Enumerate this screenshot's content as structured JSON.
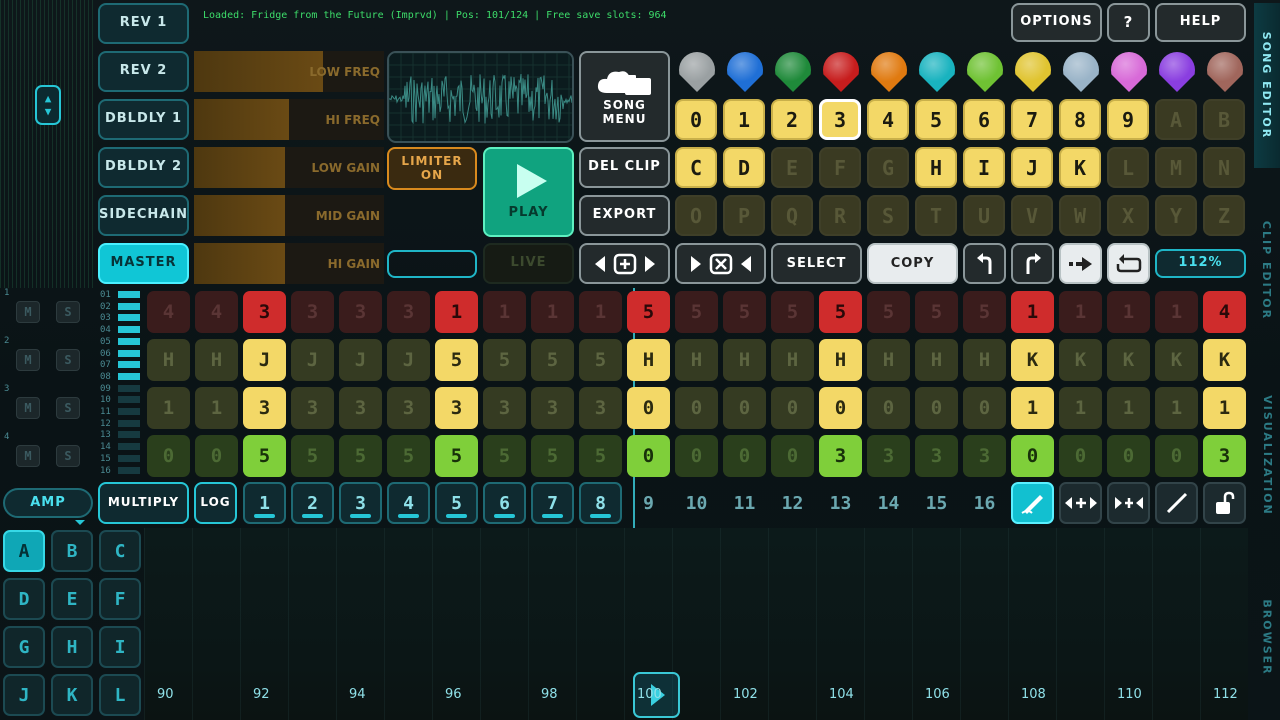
{
  "status_text": "Loaded: Fridge from the Future (Imprvd) | Pos: 101/124 | Free save slots: 964",
  "header": {
    "options": "OPTIONS",
    "question": "?",
    "help": "HELP"
  },
  "buses": [
    "REV 1",
    "REV 2",
    "DBLDLY 1",
    "DBLDLY 2",
    "SIDECHAIN",
    "MASTER"
  ],
  "eq": [
    {
      "label": "LOW FREQ",
      "level": 0.68
    },
    {
      "label": "HI FREQ",
      "level": 0.5
    },
    {
      "label": "LOW GAIN",
      "level": 0.48
    },
    {
      "label": "MID GAIN",
      "level": 0.48
    },
    {
      "label": "HI GAIN",
      "level": 0.48
    }
  ],
  "limiter": "LIMITER ON",
  "play": "PLAY",
  "live": "LIVE",
  "song_menu": "SONG MENU",
  "del_clip": "DEL CLIP",
  "export": "EXPORT",
  "picks": [
    "#9aa0a2",
    "#1f6fd6",
    "#1f8a3a",
    "#c71d1d",
    "#e07a10",
    "#19b3bf",
    "#6fc233",
    "#e0c430",
    "#9ab4c8",
    "#d86ad8",
    "#8a3ee0",
    "#a0665c"
  ],
  "pattern_keys": [
    [
      "0",
      "1",
      "2",
      "3",
      "4",
      "5",
      "6",
      "7",
      "8",
      "9",
      "A",
      "B"
    ],
    [
      "C",
      "D",
      "E",
      "F",
      "G",
      "H",
      "I",
      "J",
      "K",
      "L",
      "M",
      "N"
    ],
    [
      "O",
      "P",
      "Q",
      "R",
      "S",
      "T",
      "U",
      "V",
      "W",
      "X",
      "Y",
      "Z"
    ]
  ],
  "toolbar": {
    "select": "SELECT",
    "copy": "COPY",
    "zoom": "112%"
  },
  "tracks": [
    {
      "values": [
        "4",
        "4",
        "3",
        "3",
        "3",
        "3",
        "1",
        "1",
        "1",
        "1",
        "5",
        "5",
        "5",
        "5",
        "5",
        "5",
        "5",
        "5",
        "1",
        "1",
        "1",
        "1",
        "4"
      ]
    },
    {
      "values": [
        "H",
        "H",
        "J",
        "J",
        "J",
        "J",
        "5",
        "5",
        "5",
        "5",
        "H",
        "H",
        "H",
        "H",
        "H",
        "H",
        "H",
        "H",
        "K",
        "K",
        "K",
        "K",
        "K"
      ]
    },
    {
      "values": [
        "1",
        "1",
        "3",
        "3",
        "3",
        "3",
        "3",
        "3",
        "3",
        "3",
        "0",
        "0",
        "0",
        "0",
        "0",
        "0",
        "0",
        "0",
        "1",
        "1",
        "1",
        "1",
        "1"
      ]
    },
    {
      "values": [
        "0",
        "0",
        "5",
        "5",
        "5",
        "5",
        "5",
        "5",
        "5",
        "5",
        "0",
        "0",
        "0",
        "0",
        "3",
        "3",
        "3",
        "3",
        "0",
        "0",
        "0",
        "0",
        "3"
      ]
    }
  ],
  "mute": "M",
  "solo": "S",
  "track_numbers": [
    "1",
    "2",
    "3",
    "4"
  ],
  "step_ruler": [
    "01",
    "02",
    "03",
    "04",
    "05",
    "06",
    "07",
    "08",
    "09",
    "10",
    "11",
    "12",
    "13",
    "14",
    "15",
    "16"
  ],
  "amp": "AMP",
  "multiply": "MULTIPLY",
  "log": "LOG",
  "steps": [
    "1",
    "2",
    "3",
    "4",
    "5",
    "6",
    "7",
    "8",
    "9",
    "10",
    "11",
    "12",
    "13",
    "14",
    "15",
    "16"
  ],
  "letters": [
    "A",
    "B",
    "C",
    "D",
    "E",
    "F",
    "G",
    "H",
    "I",
    "J",
    "K",
    "L"
  ],
  "timeline_labels": [
    "90",
    "92",
    "94",
    "96",
    "98",
    "100",
    "102",
    "104",
    "106",
    "108",
    "110",
    "112"
  ],
  "tabs": [
    "SONG EDITOR",
    "CLIP EDITOR",
    "VISUALIZATION",
    "BROWSER"
  ]
}
